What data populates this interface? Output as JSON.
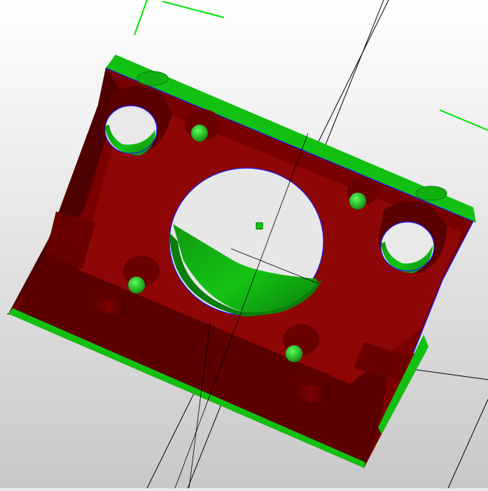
{
  "viewport": {
    "background_top": "#ffffff",
    "background_bottom": "#c8c8c8",
    "axis_color": "#000000",
    "axis_indicator_color": "#00e000",
    "center_marker_color": "#00d000"
  },
  "model": {
    "face_color": "#7a0000",
    "face_shadow_color": "#4f0000",
    "face_highlight_color": "#8f0606",
    "inner_wall_color": "#12c012",
    "inner_wall_dark_color": "#0a8f0a",
    "edge_color": "#1a1aff",
    "features": [
      "large-center-bore",
      "corner-hole-top-left",
      "corner-hole-right",
      "small-hole-top",
      "small-hole-top-right",
      "small-hole-left",
      "small-hole-bottom",
      "standoff-left",
      "standoff-bottom"
    ]
  }
}
